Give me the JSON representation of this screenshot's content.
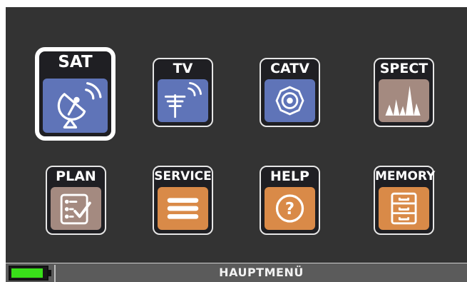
{
  "menu": {
    "items": [
      {
        "label": "SAT",
        "icon": "satellite-dish-icon",
        "color": "#5f74b8",
        "selected": true
      },
      {
        "label": "TV",
        "icon": "tv-antenna-icon",
        "color": "#5f74b8"
      },
      {
        "label": "CATV",
        "icon": "catv-connector-icon",
        "color": "#5f74b8"
      },
      {
        "label": "SPECT",
        "icon": "spectrum-icon",
        "color": "#a48a80"
      },
      {
        "label": "PLAN",
        "icon": "checklist-icon",
        "color": "#a48a80"
      },
      {
        "label": "SERVICE",
        "icon": "menu-lines-icon",
        "color": "#d98a48"
      },
      {
        "label": "HELP",
        "icon": "question-icon",
        "color": "#d98a48"
      },
      {
        "label": "MEMORY",
        "icon": "drawers-icon",
        "color": "#d98a48"
      }
    ]
  },
  "status": {
    "title": "HAUPTMENÜ",
    "battery_level": 0.92,
    "battery_color": "#39e019"
  }
}
